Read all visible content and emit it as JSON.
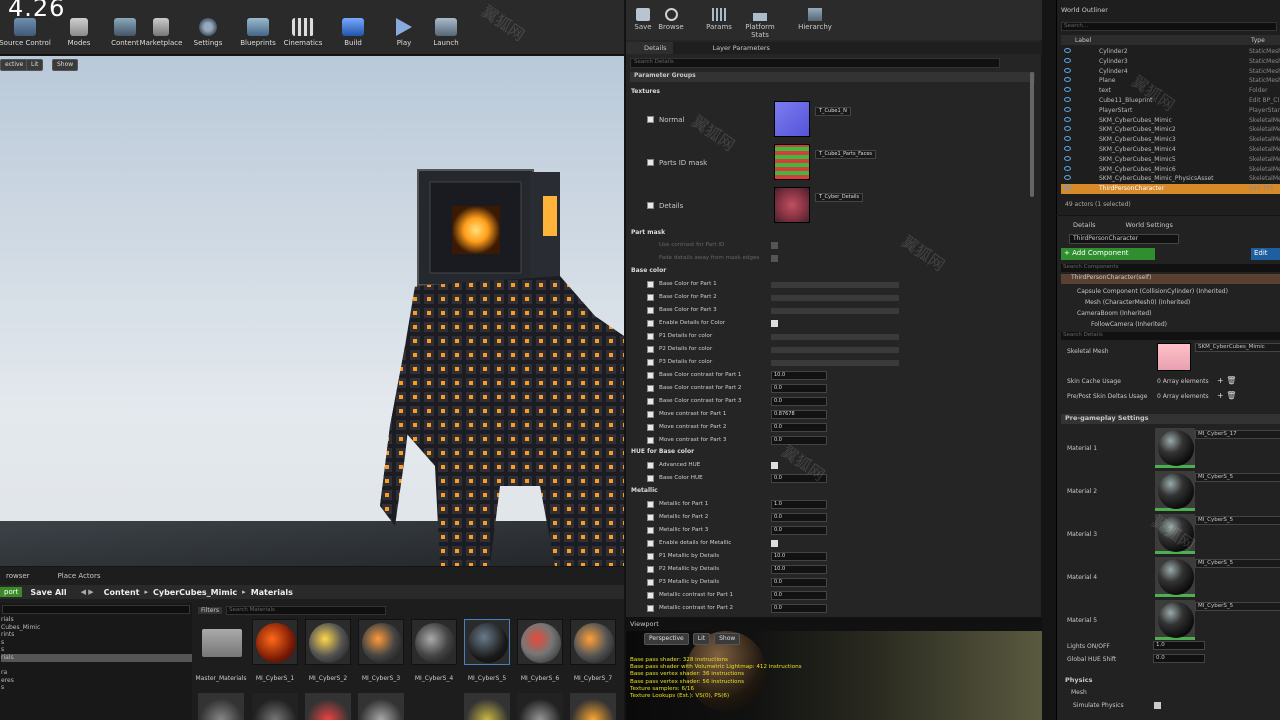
{
  "app": {
    "version": "4.26"
  },
  "toolbar": {
    "items": [
      "Source Control",
      "Modes",
      "Content",
      "Marketplace",
      "Settings",
      "Blueprints",
      "Cinematics",
      "Build",
      "Play",
      "Launch"
    ]
  },
  "viewport": {
    "perspective": "ective",
    "lit": "Lit",
    "show": "Show"
  },
  "content_browser": {
    "tabs": [
      "rowser",
      "Place Actors"
    ],
    "import_label": "port",
    "save_all": "Save All",
    "path": [
      "Content",
      "CyberCubes_Mimic",
      "Materials"
    ],
    "filters": "Filters",
    "search_placeholder": "Search Materials",
    "tree": [
      "rials",
      "Cubes_Mimic",
      "rints",
      "s",
      "s",
      "rials",
      "ra",
      "eres",
      "s"
    ],
    "thumbs": [
      "Master_Materials",
      "MI_CyberS_1",
      "MI_CyberS_2",
      "MI_CyberS_3",
      "MI_CyberS_4",
      "MI_CyberS_5",
      "MI_CyberS_6",
      "MI_CyberS_7"
    ]
  },
  "material_editor": {
    "toolbar": [
      "Save",
      "Browse",
      "Params",
      "Platform Stats",
      "Hierarchy"
    ],
    "tabs": [
      "Details",
      "Layer Parameters"
    ],
    "search_placeholder": "Search Details",
    "parameter_groups": "Parameter Groups",
    "textures_label": "Textures",
    "textures": [
      {
        "label": "Normal",
        "value": "T_Cube1_N"
      },
      {
        "label": "Parts ID mask",
        "value": "T_Cube1_Parts_Faces"
      },
      {
        "label": "Details",
        "value": "T_Cyber_Details"
      }
    ],
    "sections": {
      "part_mask": "Part mask",
      "base_color": "Base color",
      "hue": "HUE for Base color",
      "metallic": "Metallic"
    },
    "part_mask_rows": [
      "Use contrast for Part ID",
      "Fade details away from mask edges"
    ],
    "base_color_rows": [
      {
        "label": "Base Color for Part 1",
        "type": "bar"
      },
      {
        "label": "Base Color for Part 2",
        "type": "bar"
      },
      {
        "label": "Base Color for Part 3",
        "type": "bar"
      },
      {
        "label": "Enable Details for Color",
        "type": "check"
      },
      {
        "label": "P1 Details for color",
        "type": "bar"
      },
      {
        "label": "P2 Details for color",
        "type": "bar"
      },
      {
        "label": "P3 Details for color",
        "type": "bar"
      },
      {
        "label": "Base Color contrast for Part 1",
        "type": "val",
        "value": "10.0"
      },
      {
        "label": "Base Color contrast for Part 2",
        "type": "val",
        "value": "0.0"
      },
      {
        "label": "Base Color contrast for Part 3",
        "type": "val",
        "value": "0.0"
      },
      {
        "label": "Move contrast for Part 1",
        "type": "val",
        "value": "0.87678"
      },
      {
        "label": "Move contrast for Part 2",
        "type": "val",
        "value": "0.0"
      },
      {
        "label": "Move contrast for Part 3",
        "type": "val",
        "value": "0.0"
      }
    ],
    "hue_rows": [
      {
        "label": "Advanced HUE",
        "type": "check"
      },
      {
        "label": "Base Color HUE",
        "type": "val",
        "value": "0.0"
      }
    ],
    "metallic_rows": [
      {
        "label": "Metallic for Part 1",
        "value": "1.0"
      },
      {
        "label": "Metallic for Part 2",
        "value": "0.0"
      },
      {
        "label": "Metallic for Part 3",
        "value": "0.0"
      },
      {
        "label": "Enable details for Metallic",
        "value": ""
      },
      {
        "label": "P1 Metallic by Details",
        "value": "10.0"
      },
      {
        "label": "P2 Metallic by Details",
        "value": "10.0"
      },
      {
        "label": "P3 Metallic by Details",
        "value": "0.0"
      },
      {
        "label": "Metallic contrast for Part 1",
        "value": "0.0"
      },
      {
        "label": "Metallic contrast for Part 2",
        "value": "0.0"
      }
    ],
    "small_viewport": {
      "tab": "Viewport",
      "perspective": "Perspective",
      "lit": "Lit",
      "show": "Show",
      "stats": [
        "Base pass shader: 328 instructions",
        "Base pass shader with Volumetric Lightmap: 412 instructions",
        "Base pass vertex shader: 36 instructions",
        "Base pass vertex shader: 56 instructions",
        "Texture samplers: 6/16",
        "Texture Lookups (Est.): VS(0), PS(6)"
      ]
    }
  },
  "world_outliner": {
    "tab": "World Outliner",
    "search_placeholder": "Search...",
    "col_label": "Label",
    "col_type": "Type",
    "rows": [
      {
        "label": "Cylinder2",
        "type": "StaticMesh"
      },
      {
        "label": "Cylinder3",
        "type": "StaticMesh"
      },
      {
        "label": "Cylinder4",
        "type": "StaticMesh"
      },
      {
        "label": "Plane",
        "type": "StaticMesh"
      },
      {
        "label": "text",
        "type": "Folder"
      },
      {
        "label": "Cube11_Blueprint",
        "type": "Edit BP_Cl"
      },
      {
        "label": "PlayerStart",
        "type": "PlayerStart"
      },
      {
        "label": "SKM_CyberCubes_Mimic",
        "type": "SkeletalMe"
      },
      {
        "label": "SKM_CyberCubes_Mimic2",
        "type": "SkeletalMe"
      },
      {
        "label": "SKM_CyberCubes_Mimic3",
        "type": "SkeletalMe"
      },
      {
        "label": "SKM_CyberCubes_Mimic4",
        "type": "SkeletalMe"
      },
      {
        "label": "SKM_CyberCubes_Mimic5",
        "type": "SkeletalMe"
      },
      {
        "label": "SKM_CyberCubes_Mimic6",
        "type": "SkeletalMe"
      },
      {
        "label": "SKM_CyberCubes_Mimic_PhysicsAsset",
        "type": "SkeletalMe"
      },
      {
        "label": "ThirdPersonCharacter",
        "type": "Edit TPS"
      }
    ],
    "footer": "49 actors (1 selected)"
  },
  "details": {
    "tabs": [
      "Details",
      "World Settings"
    ],
    "actor_name": "ThirdPersonCharacter",
    "add_component": "+ Add Component",
    "edit": "Edit",
    "search_components": "Search Components",
    "components": [
      "ThirdPersonCharacter(self)",
      "Capsule Component (CollisionCylinder) (Inherited)",
      "Mesh (CharacterMesh0) (Inherited)",
      "CameraBoom (Inherited)",
      "FollowCamera (Inherited)"
    ],
    "search_details": "Search Details",
    "skeletal_mesh_label": "Skeletal Mesh",
    "skeletal_mesh_value": "SKM_CyberCubes_Mimic",
    "skin_cache": "Skin Cache Usage",
    "skin_cache_value": "0 Array elements",
    "skin_deltas": "Pre/Post Skin Deltas Usage",
    "skin_deltas_value": "0 Array elements",
    "pregame": "Pre-gameplay Settings",
    "materials": [
      {
        "label": "Material 1",
        "value": "MI_CyberS_17"
      },
      {
        "label": "Material 2",
        "value": "MI_CyberS_5"
      },
      {
        "label": "Material 3",
        "value": "MI_CyberS_5"
      },
      {
        "label": "Material 4",
        "value": "MI_CyberS_5"
      },
      {
        "label": "Material 5",
        "value": "MI_CyberS_5"
      }
    ],
    "lights": "Lights ON/OFF",
    "lights_value": "1.0",
    "hue_shift": "Global HUE Shift",
    "hue_shift_value": "0.0",
    "physics": "Physics",
    "mesh": "Mesh",
    "simulate": "Simulate Physics"
  }
}
